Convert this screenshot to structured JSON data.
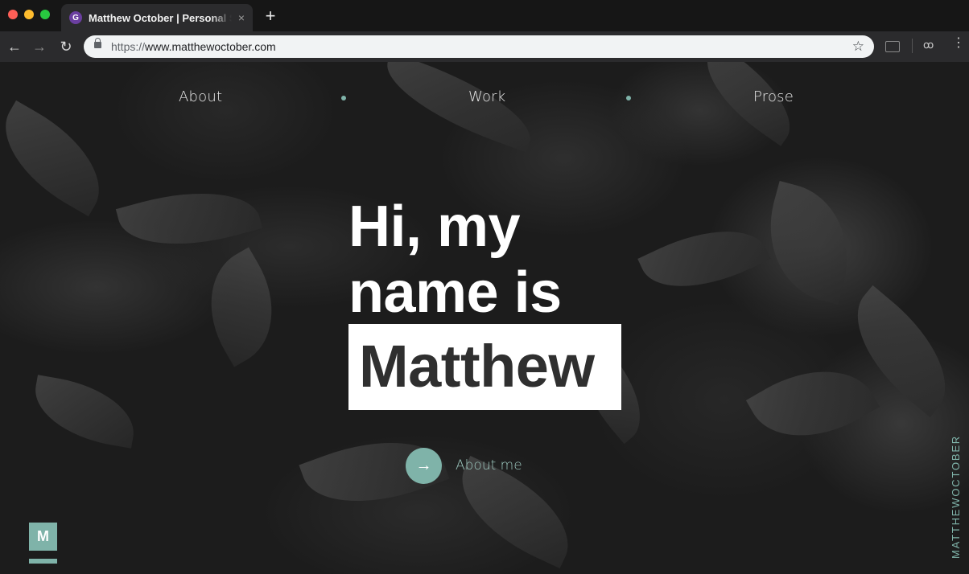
{
  "browser": {
    "tab_title": "Matthew October | Personal Site",
    "favicon": "gatsby-icon",
    "close_glyph": "×",
    "new_tab_glyph": "+",
    "url_scheme": "https://",
    "url_host": "www.matthewoctober.com",
    "back_glyph": "←",
    "forward_glyph": "→",
    "reload_glyph": "↻",
    "star_glyph": "☆",
    "incognito_glyph": "ꝏ",
    "menu_glyph": "⋮"
  },
  "nav": {
    "items": [
      {
        "label": "About"
      },
      {
        "label": "Work"
      },
      {
        "label": "Prose"
      }
    ],
    "accent_color": "#7fb3a9"
  },
  "hero": {
    "line1": "Hi, my",
    "line2": "name is",
    "name": "Matthew"
  },
  "cta": {
    "arrow": "→",
    "label": "About me"
  },
  "brand": {
    "logo_letter": "M",
    "vertical_text": "MATTHEWOCTOBER"
  }
}
